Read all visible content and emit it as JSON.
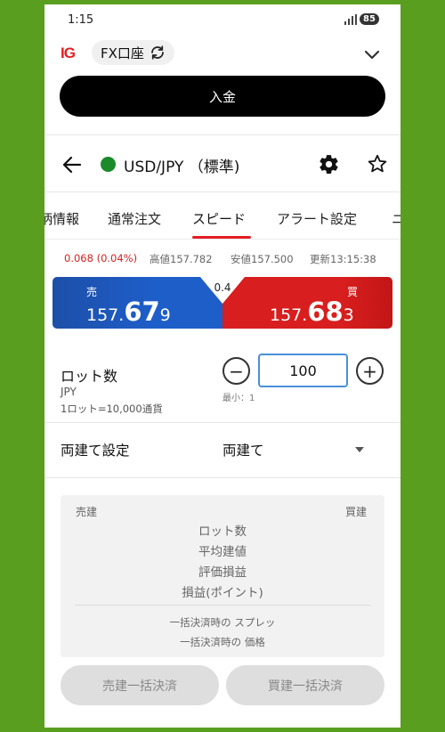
{
  "status": {
    "time": "1:15",
    "battery": "85"
  },
  "appbar": {
    "logo": "IG",
    "account": "FX口座"
  },
  "deposit_label": "入金",
  "instrument": {
    "name": "USD/JPY （標準)"
  },
  "tabs": [
    "柄情報",
    "通常注文",
    "スピード",
    "アラート設定",
    "ニ"
  ],
  "active_tab": "スピード",
  "stats": {
    "change": "0.068 (0.04%)",
    "high": "高値157.782",
    "low": "安値157.500",
    "updated": "更新13:15:38"
  },
  "prices": {
    "sell_label": "売",
    "buy_label": "買",
    "spread": "0.4",
    "sell": {
      "prefix": "157.",
      "big": "67",
      "suffix": "9"
    },
    "buy": {
      "prefix": "157.",
      "big": "68",
      "suffix": "3"
    },
    "colors": {
      "sell": "#1e5ec9",
      "buy": "#d81e1e"
    }
  },
  "lot": {
    "label": "ロット数",
    "currency": "JPY",
    "unit_note": "1ロット=10,000通貨",
    "value": "100",
    "min_hint": "最小：1",
    "minus": "−",
    "plus": "+"
  },
  "hedge": {
    "label": "両建て設定",
    "value": "両建て"
  },
  "summary": {
    "sell_header": "売建",
    "buy_header": "買建",
    "rows": [
      "ロット数",
      "平均建値",
      "評価損益",
      "損益(ポイント)"
    ],
    "bulk_spread": "一括決済時の スプレッ",
    "bulk_price": "一括決済時の 価格"
  },
  "buttons": {
    "sell_close_all": "売建一括決済",
    "buy_close_all": "買建一括決済"
  }
}
